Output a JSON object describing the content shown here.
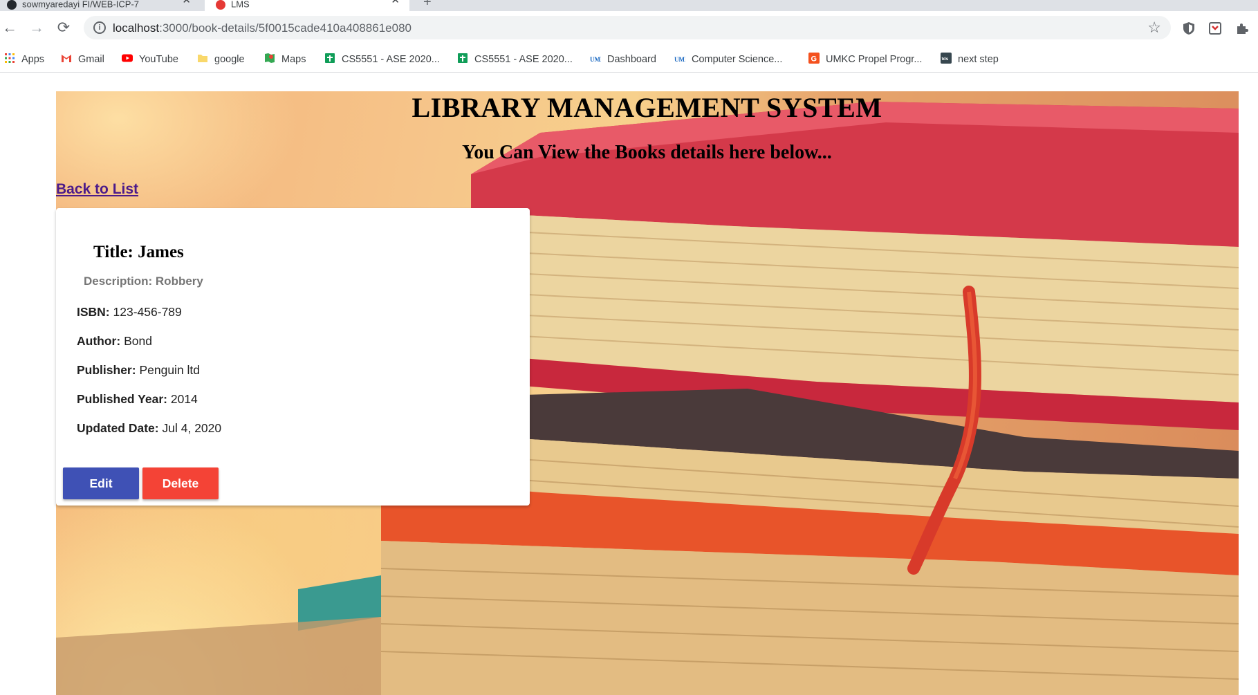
{
  "browser": {
    "tabs": [
      {
        "label": "sowmyaredayi FI/WEB-ICP-7",
        "active": false
      },
      {
        "label": "LMS",
        "active": true
      }
    ],
    "address": {
      "host": "localhost",
      "path": ":3000/book-details/5f0015cade410a408861e080"
    },
    "bookmarks": [
      {
        "label": "Apps",
        "icon": "apps-grid-icon"
      },
      {
        "label": "Gmail",
        "icon": "gmail-icon"
      },
      {
        "label": "YouTube",
        "icon": "youtube-icon"
      },
      {
        "label": "google",
        "icon": "folder-icon"
      },
      {
        "label": "Maps",
        "icon": "maps-icon"
      },
      {
        "label": "CS5551 - ASE 2020...",
        "icon": "sheets-icon"
      },
      {
        "label": "CS5551 - ASE 2020...",
        "icon": "sheets-icon"
      },
      {
        "label": "Dashboard",
        "icon": "umkc-icon"
      },
      {
        "label": "Computer Science...",
        "icon": "umkc-icon"
      },
      {
        "label": "UMKC Propel Progr...",
        "icon": "g-icon"
      },
      {
        "label": "next step",
        "icon": "tds-icon"
      }
    ]
  },
  "page": {
    "title": "LIBRARY MANAGEMENT SYSTEM",
    "subtitle": "You Can View the Books details here below...",
    "back_link": "Back to List",
    "book": {
      "title_label": "Title: ",
      "title": "James",
      "description_label": "Description: ",
      "description": "Robbery",
      "fields": [
        {
          "label": "ISBN:",
          "value": "123-456-789"
        },
        {
          "label": "Author:",
          "value": "Bond"
        },
        {
          "label": "Publisher:",
          "value": "Penguin ltd"
        },
        {
          "label": "Published Year:",
          "value": "2014"
        },
        {
          "label": "Updated Date:",
          "value": "Jul 4, 2020"
        }
      ]
    },
    "actions": {
      "edit": "Edit",
      "delete": "Delete"
    }
  },
  "colors": {
    "edit": "#3f51b5",
    "delete": "#f44336",
    "link": "#4b1a8a"
  }
}
